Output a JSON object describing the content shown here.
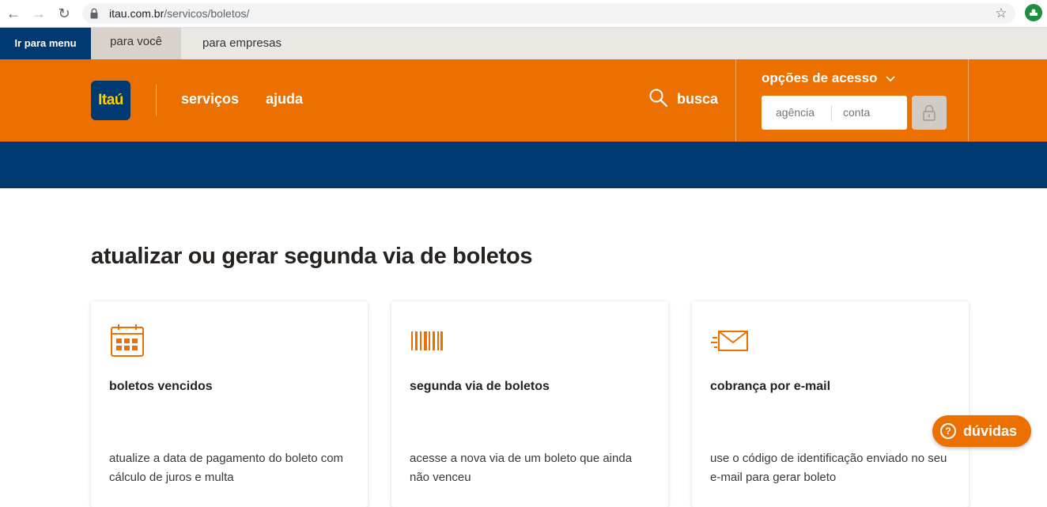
{
  "browser": {
    "url_host": "itau.com.br",
    "url_path": "/servicos/boletos/"
  },
  "topbar": {
    "skip_label": "Ir para menu",
    "tabs": [
      {
        "label": "para você"
      },
      {
        "label": "para empresas"
      }
    ]
  },
  "header": {
    "logo_text": "Itaú",
    "nav": [
      {
        "label": "serviços"
      },
      {
        "label": "ajuda"
      }
    ],
    "search_label": "busca",
    "access": {
      "title": "opções de acesso",
      "agencia_placeholder": "agência",
      "conta_placeholder": "conta"
    }
  },
  "main": {
    "title": "atualizar ou gerar segunda via de boletos",
    "cards": [
      {
        "icon": "calendar-icon",
        "title": "boletos vencidos",
        "description": "atualize a data de pagamento do boleto com cálculo de juros e multa"
      },
      {
        "icon": "barcode-icon",
        "title": "segunda via de boletos",
        "description": "acesse a nova via de um boleto que ainda não venceu"
      },
      {
        "icon": "email-icon",
        "title": "cobrança por e-mail",
        "description": "use o código de identificação enviado no seu e-mail para gerar boleto"
      }
    ]
  },
  "help_button": {
    "icon": "question-icon",
    "label": "dúvidas"
  },
  "colors": {
    "orange": "#ec7000",
    "navy": "#003a70",
    "yellow": "#fcd000"
  }
}
